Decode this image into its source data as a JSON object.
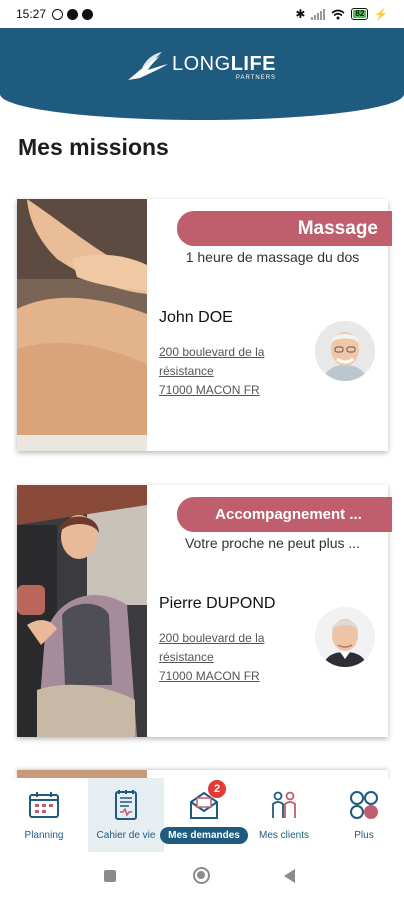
{
  "status_bar": {
    "time": "15:27",
    "battery": "82"
  },
  "brand": {
    "name_light": "LONG",
    "name_bold": "LIFE",
    "sub": "PARTNERS"
  },
  "page_title": "Mes missions",
  "missions": [
    {
      "tag": "Massage",
      "subtitle": "1 heure de massage du dos",
      "client": "John DOE",
      "address_lines": [
        "200 boulevard de la",
        "résistance",
        "71000 MACON FR"
      ],
      "photo_icon": "massage-photo",
      "avatar_icon": "elderly-man-avatar"
    },
    {
      "tag": "Accompagnement ...",
      "subtitle": "Votre proche ne peut plus ...",
      "client": "Pierre DUPOND",
      "address_lines": [
        "200 boulevard de la",
        "résistance",
        "71000 MACON FR"
      ],
      "photo_icon": "car-escort-photo",
      "avatar_icon": "elderly-man-avatar"
    }
  ],
  "bottom_nav": [
    {
      "label": "Planning",
      "icon": "calendar-icon"
    },
    {
      "label": "Cahier de vie",
      "icon": "notebook-icon",
      "highlighted": true
    },
    {
      "label": "Mes demandes",
      "icon": "mail-icon",
      "active": true,
      "badge": "2"
    },
    {
      "label": "Mes clients",
      "icon": "people-icon"
    },
    {
      "label": "Plus",
      "icon": "more-grid-icon"
    }
  ],
  "colors": {
    "primary": "#1e5b7e",
    "accent": "#bf5f6d",
    "badge": "#e53935"
  }
}
